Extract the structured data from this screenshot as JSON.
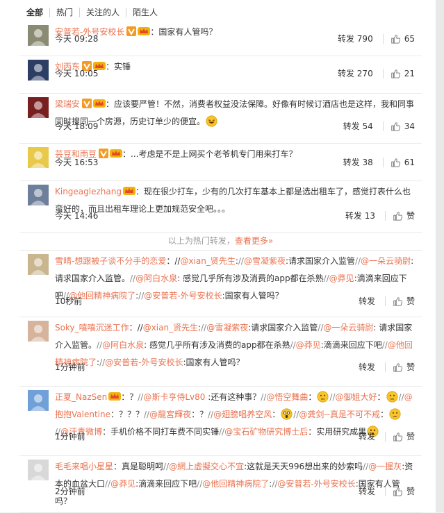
{
  "tabs": [
    "全部",
    "热门",
    "关注的人",
    "陌生人"
  ],
  "hot_divider": {
    "text": "以上为热门转发，",
    "link": "查看更多»"
  },
  "colors": {
    "accent": "#eb7350",
    "badge_orange": "#f29b27",
    "vip_yellow": "#f0b30c"
  },
  "reposts": [
    {
      "user": "安普若-外号安校长",
      "badges": [
        "verified-v-badge",
        "vip-crown-badge"
      ],
      "content": [
        {
          "t": "：国家有人管吗？"
        }
      ],
      "time": "今天 09:28",
      "repost_label": "转发 790",
      "like_count": "65"
    },
    {
      "user": "刘丙东",
      "badges": [
        "verified-v-badge",
        "vip-crown-badge"
      ],
      "content": [
        {
          "t": "：实锤"
        }
      ],
      "time": "今天 10:05",
      "repost_label": "转发 270",
      "like_count": "21"
    },
    {
      "user": "梁瑞安",
      "badges": [
        "verified-v-badge",
        "vip-crown-badge"
      ],
      "content": [
        {
          "t": "：应该要严管！不然，消费者权益没法保障。好像有时候订酒店也是这样，我和同事同时搜同一个房源，历史订单少的便宜。"
        },
        {
          "emoji": "laughing-emoji"
        }
      ],
      "time": "今天 18:09",
      "repost_label": "转发 54",
      "like_count": "34"
    },
    {
      "user": "芸豆和雨豆",
      "badges": [
        "verified-v-badge",
        "vip-crown-badge"
      ],
      "content": [
        {
          "t": "：...考虑是不是上网买个老爷机专门用来打车？"
        }
      ],
      "time": "今天 16:53",
      "repost_label": "转发 38",
      "like_count": "61"
    },
    {
      "user": "Kingeaglezhang",
      "badges": [
        "vip-crown-badge"
      ],
      "content": [
        {
          "t": "：现在很少打车，少有的几次打车基本上都是选出租车了，感觉打表什么也蛮好的，而且出租车理论上更加规范安全吧。。。"
        }
      ],
      "time": "今天 14:46",
      "repost_label": "转发 13",
      "like_count": "赞"
    },
    {
      "user": "雪晴-想跟被子谈不分手的恋爱",
      "badges": [],
      "content": [
        {
          "t": "：//"
        },
        {
          "m": "@xian_贤先生"
        },
        {
          "t": ":"
        },
        {
          "sep": "//"
        },
        {
          "m": "@雪凝紫夜"
        },
        {
          "t": ":请求国家介入监管"
        },
        {
          "sep": "//"
        },
        {
          "m": "@一朵云骑尉"
        },
        {
          "t": ":请求国家介入监管。"
        },
        {
          "sep": "//"
        },
        {
          "m": "@阿白水泉"
        },
        {
          "t": ": 感觉几乎所有涉及消费的app都在杀熟"
        },
        {
          "sep": "//"
        },
        {
          "m": "@莽见"
        },
        {
          "t": ":滴滴来回应下吧"
        },
        {
          "sep": "//"
        },
        {
          "m": "@他回精神病院了"
        },
        {
          "t": ":"
        },
        {
          "sep": "//"
        },
        {
          "m": "@安普若-外号安校长"
        },
        {
          "t": ":国家有人管吗？"
        }
      ],
      "time": "10秒前",
      "repost_label": "转发",
      "like_count": "赞"
    },
    {
      "user": "Soky_嘻嘻沉迷工作",
      "badges": [],
      "content": [
        {
          "t": "：//"
        },
        {
          "m": "@xian_贤先生"
        },
        {
          "t": ":"
        },
        {
          "sep": "//"
        },
        {
          "m": "@雪凝紫夜"
        },
        {
          "t": ":请求国家介入监管"
        },
        {
          "sep": "//"
        },
        {
          "m": "@一朵云骑尉"
        },
        {
          "t": ": 请求国家介入监管。"
        },
        {
          "sep": "//"
        },
        {
          "m": "@阿白水泉"
        },
        {
          "t": ": 感觉几乎所有涉及消费的app都在杀熟"
        },
        {
          "sep": "//"
        },
        {
          "m": "@莽见"
        },
        {
          "t": ":滴滴来回应下吧"
        },
        {
          "sep": "//"
        },
        {
          "m": "@他回精神病院了"
        },
        {
          "t": ":"
        },
        {
          "sep": "//"
        },
        {
          "m": "@安普若-外号安校长"
        },
        {
          "t": ":国家有人管吗？"
        }
      ],
      "time": "1分钟前",
      "repost_label": "转发",
      "like_count": "赞"
    },
    {
      "user": "正夏_NazSen",
      "badges": [
        "vip-crown-badge"
      ],
      "content": [
        {
          "t": "：？"
        },
        {
          "sep": "//"
        },
        {
          "m": "@斯卡亨侍Lv80"
        },
        {
          "t": " :还有这种事？"
        },
        {
          "sep": "//"
        },
        {
          "m": "@悟空舞曲"
        },
        {
          "t": "："
        },
        {
          "emoji": "thinking-emoji"
        },
        {
          "sep": "//"
        },
        {
          "m": "@御姐大好"
        },
        {
          "t": "："
        },
        {
          "emoji": "thinking-emoji"
        },
        {
          "sep": "//"
        },
        {
          "m": "@抱抱Valentine"
        },
        {
          "t": "：？？？"
        },
        {
          "sep": "//"
        },
        {
          "m": "@龍宮輝夜"
        },
        {
          "t": "：？"
        },
        {
          "sep": "//"
        },
        {
          "m": "@翅膀唱养空风"
        },
        {
          "t": "："
        },
        {
          "emoji": "shock-emoji"
        },
        {
          "sep": "//"
        },
        {
          "m": "@龚剑--真是不可不戒"
        },
        {
          "t": "："
        },
        {
          "emoji": "thinking-emoji"
        },
        {
          "sep": "//"
        },
        {
          "m": "@汗青微博"
        },
        {
          "t": "：手机价格不同打车费不同实锤"
        },
        {
          "sep": "//"
        },
        {
          "m": "@宝石矿物研究博士后"
        },
        {
          "t": "：实用研究成果"
        },
        {
          "emoji": "surprised-emoji"
        }
      ],
      "time": "1分钟前",
      "repost_label": "转发",
      "like_count": "赞"
    },
    {
      "user": "毛毛来唱小星星",
      "badges": [],
      "content": [
        {
          "t": "：真是聪明呵"
        },
        {
          "sep": "//"
        },
        {
          "m": "@網上虚擬交心不宜"
        },
        {
          "t": ":这就是天天996想出来的妙索吗"
        },
        {
          "sep": "//"
        },
        {
          "m": "@一握灰"
        },
        {
          "t": ":资本的血盆大口"
        },
        {
          "sep": "//"
        },
        {
          "m": "@莽见"
        },
        {
          "t": ":滴滴来回应下吧"
        },
        {
          "sep": "//"
        },
        {
          "m": "@他回精神病院了"
        },
        {
          "t": ":"
        },
        {
          "sep": "//"
        },
        {
          "m": "@安普若-外号安校长"
        },
        {
          "t": ":国家有人管吗？"
        }
      ],
      "time": "2分钟前",
      "repost_label": "转发",
      "like_count": "赞"
    }
  ]
}
